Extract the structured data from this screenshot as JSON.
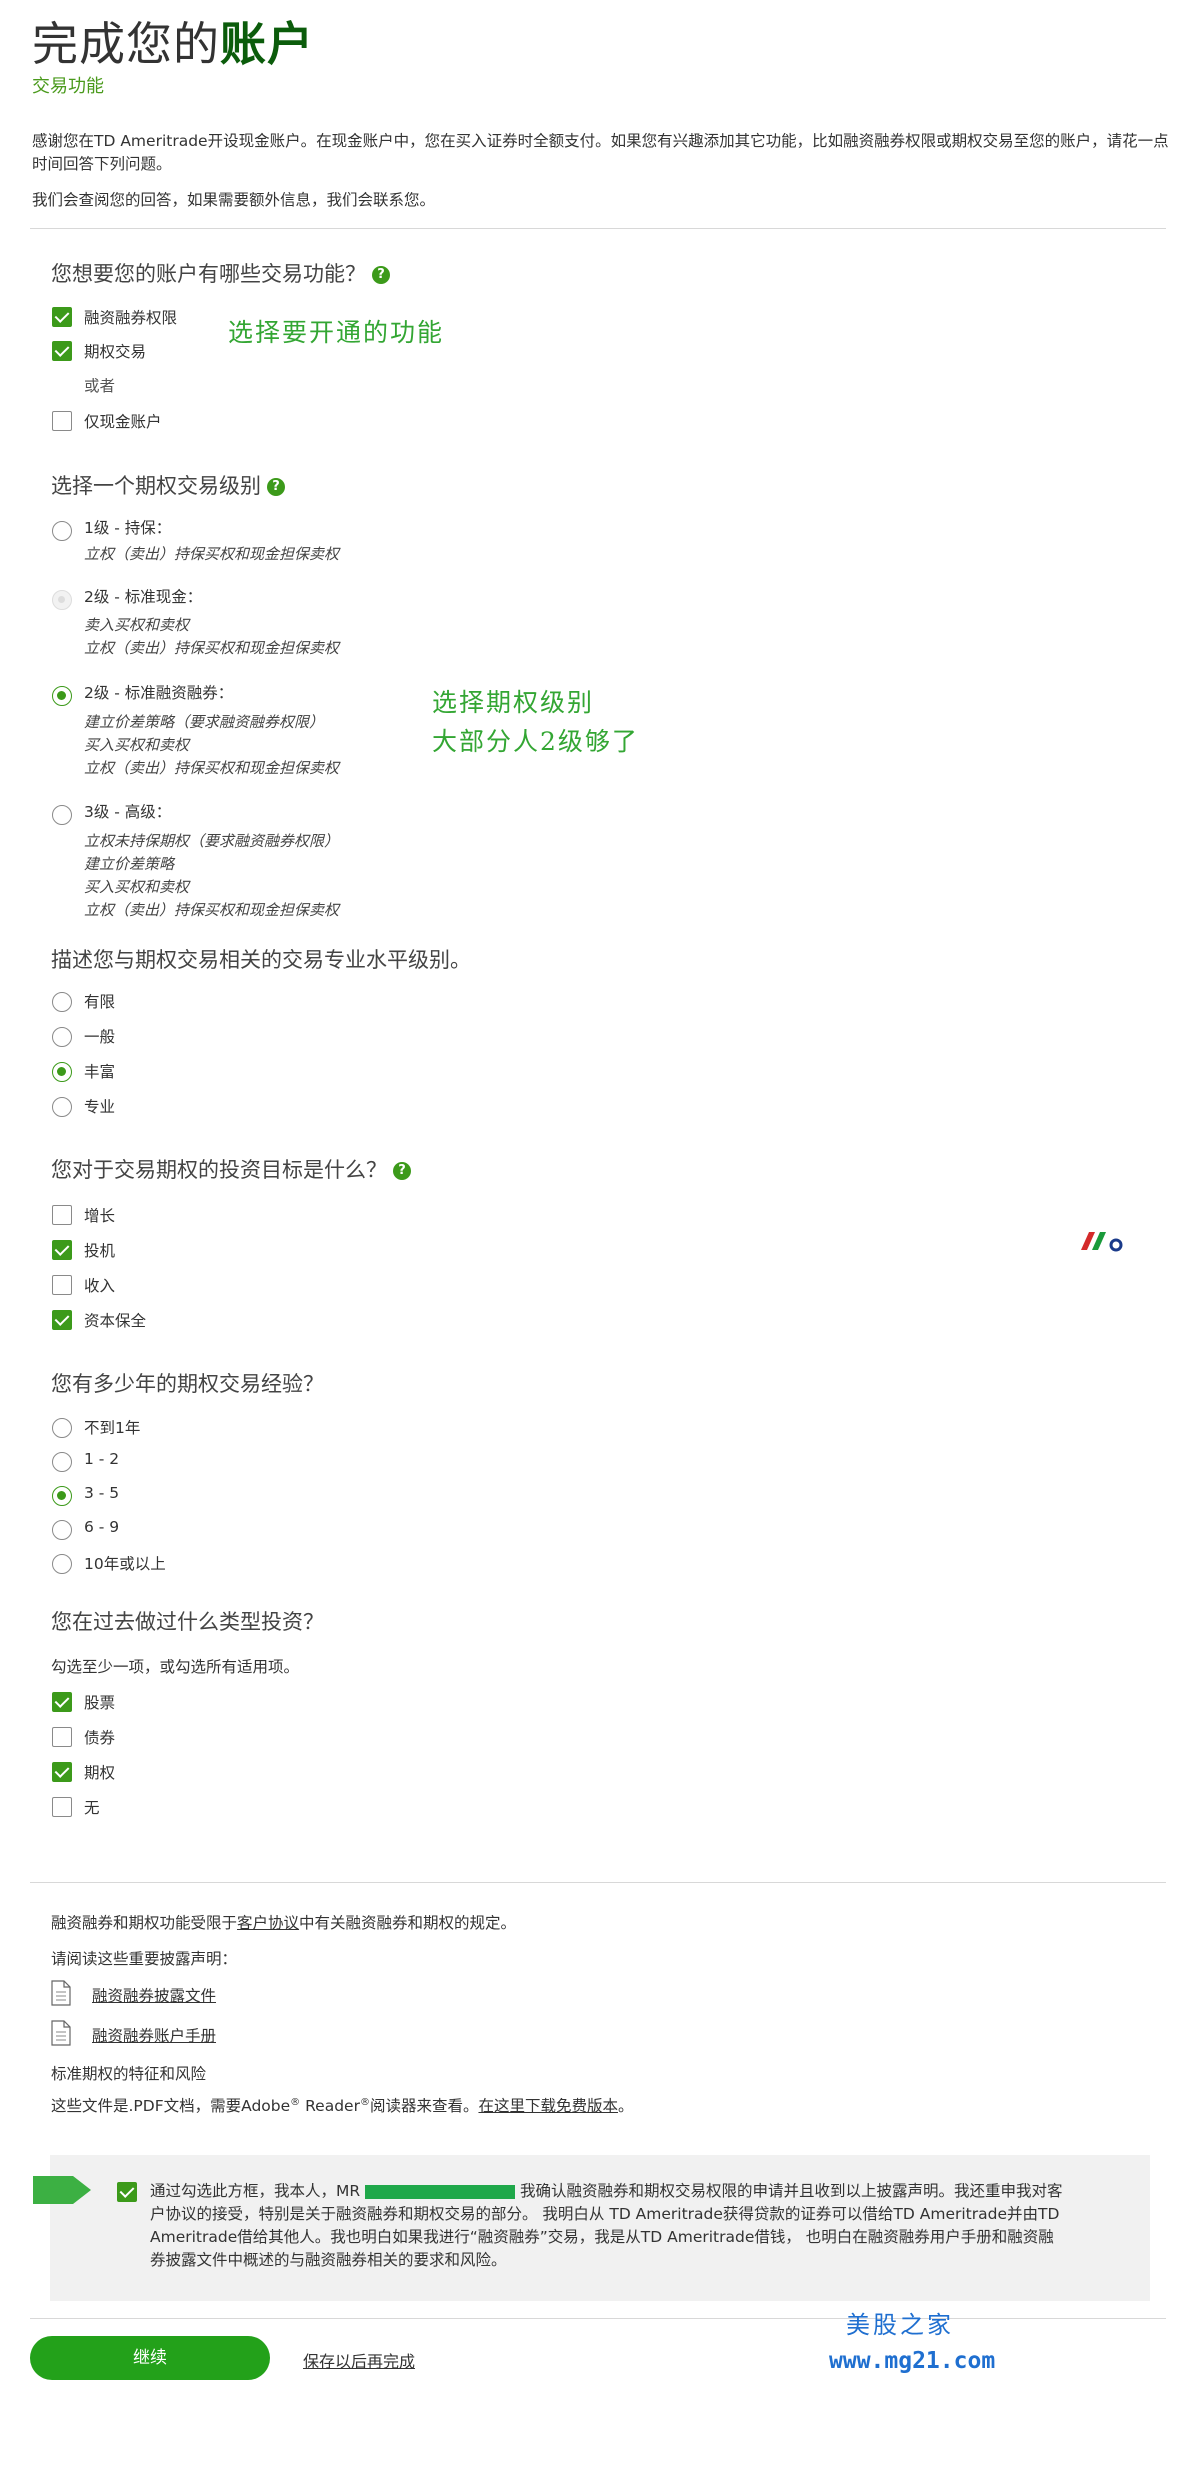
{
  "header": {
    "title_part1": "完成您的",
    "title_part2": "账户",
    "subtitle": "交易功能"
  },
  "intro": {
    "paragraph": "感谢您在TD Ameritrade开设现金账户。在现金账户中，您在买入证券时全额支付。如果您有兴趣添加其它功能，比如融资融券权限或期权交易至您的账户，请花一点时间回答下列问题。",
    "review_note": "我们会查阅您的回答，如果需要额外信息，我们会联系您。"
  },
  "q1": {
    "question": "您想要您的账户有哪些交易功能？",
    "help": "?",
    "options": [
      {
        "label": "融资融券权限",
        "checked": true
      },
      {
        "label": "期权交易",
        "checked": true
      },
      {
        "label": "仅现金账户",
        "checked": false
      }
    ],
    "or_label": "或者",
    "annotation": "选择要开通的功能"
  },
  "q2": {
    "question": "选择一个期权交易级别",
    "help": "?",
    "levels": [
      {
        "title": "1级 - 持保：",
        "desc": [
          "立权（卖出）持保买权和现金担保卖权"
        ],
        "state": "unselected"
      },
      {
        "title": "2级 - 标准现金：",
        "desc": [
          "卖入买权和卖权",
          "立权（卖出）持保买权和现金担保卖权"
        ],
        "state": "disabled"
      },
      {
        "title": "2级 - 标准融资融券：",
        "desc": [
          "建立价差策略（要求融资融券权限）",
          "买入买权和卖权",
          "立权（卖出）持保买权和现金担保卖权"
        ],
        "state": "selected"
      },
      {
        "title": "3级 - 高级：",
        "desc": [
          "立权未持保期权（要求融资融券权限）",
          "建立价差策略",
          "买入买权和卖权",
          "立权（卖出）持保买权和现金担保卖权"
        ],
        "state": "unselected"
      }
    ],
    "annotation_line1": "选择期权级别",
    "annotation_line2": "大部分人2级够了"
  },
  "q3": {
    "question": "描述您与期权交易相关的交易专业水平级别。",
    "options": [
      {
        "label": "有限",
        "selected": false
      },
      {
        "label": "一般",
        "selected": false
      },
      {
        "label": "丰富",
        "selected": true
      },
      {
        "label": "专业",
        "selected": false
      }
    ]
  },
  "q4": {
    "question": "您对于交易期权的投资目标是什么？",
    "help": "?",
    "options": [
      {
        "label": "增长",
        "checked": false
      },
      {
        "label": "投机",
        "checked": true
      },
      {
        "label": "收入",
        "checked": false
      },
      {
        "label": "资本保全",
        "checked": true
      }
    ]
  },
  "q5": {
    "question": "您有多少年的期权交易经验？",
    "options": [
      {
        "label": "不到1年",
        "selected": false
      },
      {
        "label": "1 - 2",
        "selected": false
      },
      {
        "label": "3 - 5",
        "selected": true
      },
      {
        "label": "6 - 9",
        "selected": false
      },
      {
        "label": "10年或以上",
        "selected": false
      }
    ]
  },
  "q6": {
    "question": "您在过去做过什么类型投资？",
    "hint": "勾选至少一项，或勾选所有适用项。",
    "options": [
      {
        "label": "股票",
        "checked": true
      },
      {
        "label": "债券",
        "checked": false
      },
      {
        "label": "期权",
        "checked": true
      },
      {
        "label": "无",
        "checked": false
      }
    ]
  },
  "disclosures": {
    "line1_pre": "融资融券和期权功能受限于",
    "line1_link": "客户协议",
    "line1_post": "中有关融资融券和期权的规定。",
    "read_prompt": "请阅读这些重要披露声明：",
    "doc1": "融资融券披露文件",
    "doc2": "融资融券账户手册",
    "doc3": "标准期权的特征和风险",
    "pdf_note_pre": "这些文件是.PDF文档，需要Adobe",
    "reg1": "®",
    "pdf_note_mid": " Reader",
    "reg2": "®",
    "pdf_note_post": "阅读器来查看。",
    "download_link": "在这里下载免费版本",
    "end_punct": "。"
  },
  "consent": {
    "checked": true,
    "pre": "通过勾选此方框，我本人，MR",
    "post": "我确认融资融券和期权交易权限的申请并且收到以上披露声明。我还重申我对客户协议的接受，特别是关于融资融券和期权交易的部分。 我明白从 TD Ameritrade获得贷款的证券可以借给TD Ameritrade并由TD Ameritrade借给其他人。我也明白如果我进行“融资融券”交易，我是从TD Ameritrade借钱， 也明白在融资融券用户手册和融资融券披露文件中概述的与融资融券相关的要求和风险。"
  },
  "footer": {
    "continue_label": "继续",
    "save_label": "保存以后再完成"
  },
  "watermark": {
    "line1": "美股之家",
    "line2": "www.mg21.com"
  },
  "colors": {
    "accent_green": "#3c9a1a",
    "title_green": "#0b5c0b",
    "annotation_green": "#33a633",
    "watermark_blue": "#1f6fd0",
    "consent_bg": "#f1f1f1"
  }
}
